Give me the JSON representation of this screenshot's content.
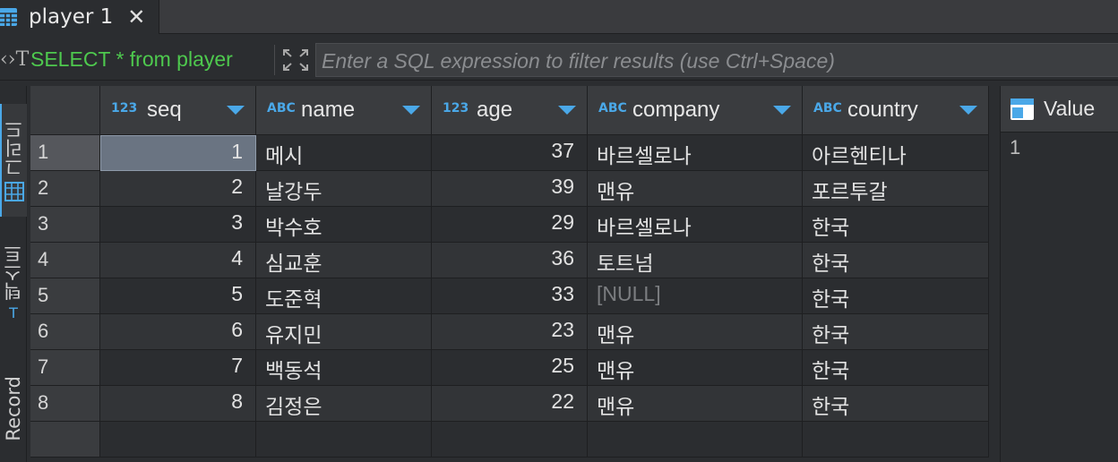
{
  "tab": {
    "title": "player 1",
    "close": "✕"
  },
  "filter": {
    "query": "SELECT * from player",
    "placeholder": "Enter a SQL expression to filter results (use Ctrl+Space)"
  },
  "sidebar": {
    "tabs": [
      {
        "label": "그리드"
      },
      {
        "label": "텍스트"
      },
      {
        "label": "Record"
      }
    ]
  },
  "grid": {
    "columns": [
      {
        "name": "seq",
        "type": "123"
      },
      {
        "name": "name",
        "type": "ABC"
      },
      {
        "name": "age",
        "type": "123"
      },
      {
        "name": "company",
        "type": "ABC"
      },
      {
        "name": "country",
        "type": "ABC"
      }
    ],
    "rows": [
      {
        "n": "1",
        "seq": "1",
        "name": "메시",
        "age": "37",
        "company": "바르셀로나",
        "country": "아르헨티나"
      },
      {
        "n": "2",
        "seq": "2",
        "name": "날강두",
        "age": "39",
        "company": "맨유",
        "country": "포르투갈"
      },
      {
        "n": "3",
        "seq": "3",
        "name": "박수호",
        "age": "29",
        "company": "바르셀로나",
        "country": "한국"
      },
      {
        "n": "4",
        "seq": "4",
        "name": "심교훈",
        "age": "36",
        "company": "토트넘",
        "country": "한국"
      },
      {
        "n": "5",
        "seq": "5",
        "name": "도준혁",
        "age": "33",
        "company": "[NULL]",
        "country": "한국"
      },
      {
        "n": "6",
        "seq": "6",
        "name": "유지민",
        "age": "23",
        "company": "맨유",
        "country": "한국"
      },
      {
        "n": "7",
        "seq": "7",
        "name": "백동석",
        "age": "25",
        "company": "맨유",
        "country": "한국"
      },
      {
        "n": "8",
        "seq": "8",
        "name": "김정은",
        "age": "22",
        "company": "맨유",
        "country": "한국"
      }
    ]
  },
  "value_panel": {
    "title": "Value",
    "value": "1"
  },
  "colors": {
    "accent": "#4aa8e8",
    "sql": "#4ec94e",
    "selection": "#6a7482"
  }
}
